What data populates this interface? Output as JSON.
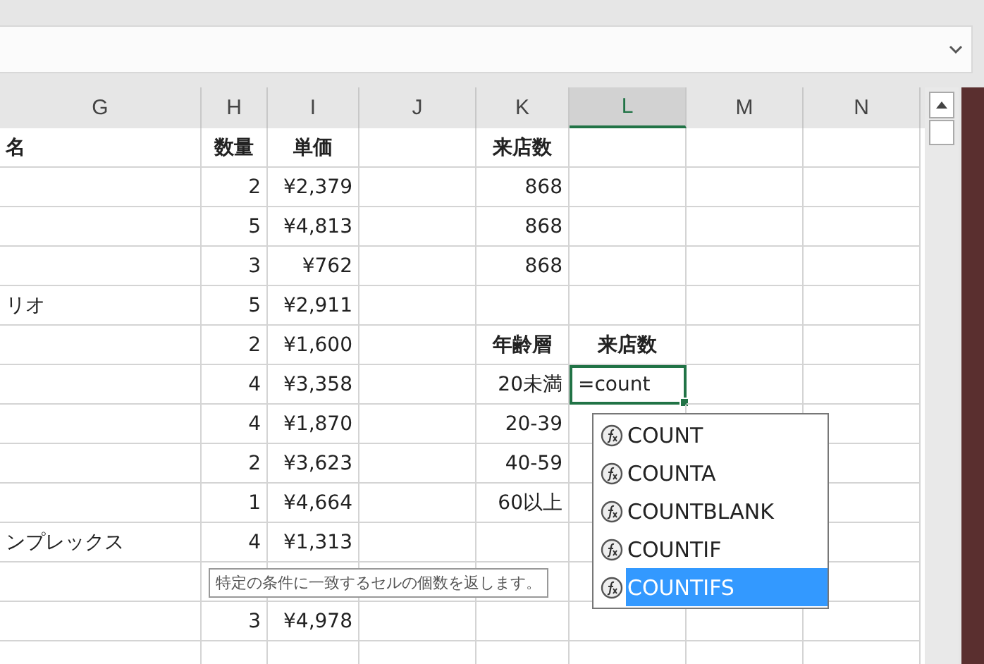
{
  "columns": [
    {
      "label": "G",
      "selected": false
    },
    {
      "label": "H",
      "selected": false
    },
    {
      "label": "I",
      "selected": false
    },
    {
      "label": "J",
      "selected": false
    },
    {
      "label": "K",
      "selected": false
    },
    {
      "label": "L",
      "selected": true
    },
    {
      "label": "M",
      "selected": false
    },
    {
      "label": "N",
      "selected": false
    }
  ],
  "rows": [
    {
      "g": {
        "text": "名",
        "bold": true,
        "editing": false
      },
      "h": {
        "text": "数量",
        "bold": true,
        "editing": false
      },
      "i": {
        "text": "単価",
        "bold": true,
        "editing": false
      },
      "k": {
        "text": "来店数",
        "bold": true,
        "editing": false
      }
    },
    {
      "h": {
        "text": "2",
        "bold": false,
        "editing": false
      },
      "i": {
        "text": "¥2,379",
        "bold": false,
        "editing": false
      },
      "k": {
        "text": "868",
        "bold": false,
        "editing": false
      }
    },
    {
      "h": {
        "text": "5",
        "bold": false,
        "editing": false
      },
      "i": {
        "text": "¥4,813",
        "bold": false,
        "editing": false
      },
      "k": {
        "text": "868",
        "bold": false,
        "editing": false
      }
    },
    {
      "h": {
        "text": "3",
        "bold": false,
        "editing": false
      },
      "i": {
        "text": "¥762",
        "bold": false,
        "editing": false
      },
      "k": {
        "text": "868",
        "bold": false,
        "editing": false
      }
    },
    {
      "g": {
        "text": "リオ",
        "bold": false,
        "editing": false
      },
      "h": {
        "text": "5",
        "bold": false,
        "editing": false
      },
      "i": {
        "text": "¥2,911",
        "bold": false,
        "editing": false
      }
    },
    {
      "h": {
        "text": "2",
        "bold": false,
        "editing": false
      },
      "i": {
        "text": "¥1,600",
        "bold": false,
        "editing": false
      },
      "k": {
        "text": "年齢層",
        "bold": true,
        "editing": false
      },
      "l": {
        "text": "来店数",
        "bold": true,
        "editing": false
      }
    },
    {
      "h": {
        "text": "4",
        "bold": false,
        "editing": false
      },
      "i": {
        "text": "¥3,358",
        "bold": false,
        "editing": false
      },
      "k": {
        "text": "20未満",
        "bold": false,
        "editing": false
      },
      "l": {
        "text": "=count",
        "bold": false,
        "editing": true
      }
    },
    {
      "h": {
        "text": "4",
        "bold": false,
        "editing": false
      },
      "i": {
        "text": "¥1,870",
        "bold": false,
        "editing": false
      },
      "k": {
        "text": "20-39",
        "bold": false,
        "editing": false
      }
    },
    {
      "h": {
        "text": "2",
        "bold": false,
        "editing": false
      },
      "i": {
        "text": "¥3,623",
        "bold": false,
        "editing": false
      },
      "k": {
        "text": "40-59",
        "bold": false,
        "editing": false
      }
    },
    {
      "h": {
        "text": "1",
        "bold": false,
        "editing": false
      },
      "i": {
        "text": "¥4,664",
        "bold": false,
        "editing": false
      },
      "k": {
        "text": "60以上",
        "bold": false,
        "editing": false
      }
    },
    {
      "g": {
        "text": "ンプレックス",
        "bold": false,
        "editing": false
      },
      "h": {
        "text": "4",
        "bold": false,
        "editing": false
      },
      "i": {
        "text": "¥1,313",
        "bold": false,
        "editing": false
      }
    },
    {},
    {
      "h": {
        "text": "3",
        "bold": false,
        "editing": false
      },
      "i": {
        "text": "¥4,978",
        "bold": false,
        "editing": false
      }
    }
  ],
  "tooltip": {
    "text": "特定の条件に一致するセルの個数を返します。"
  },
  "autocomplete": {
    "items": [
      {
        "label": "COUNT",
        "selected": false
      },
      {
        "label": "COUNTA",
        "selected": false
      },
      {
        "label": "COUNTBLANK",
        "selected": false
      },
      {
        "label": "COUNTIF",
        "selected": false
      },
      {
        "label": "COUNTIFS",
        "selected": true
      }
    ]
  }
}
